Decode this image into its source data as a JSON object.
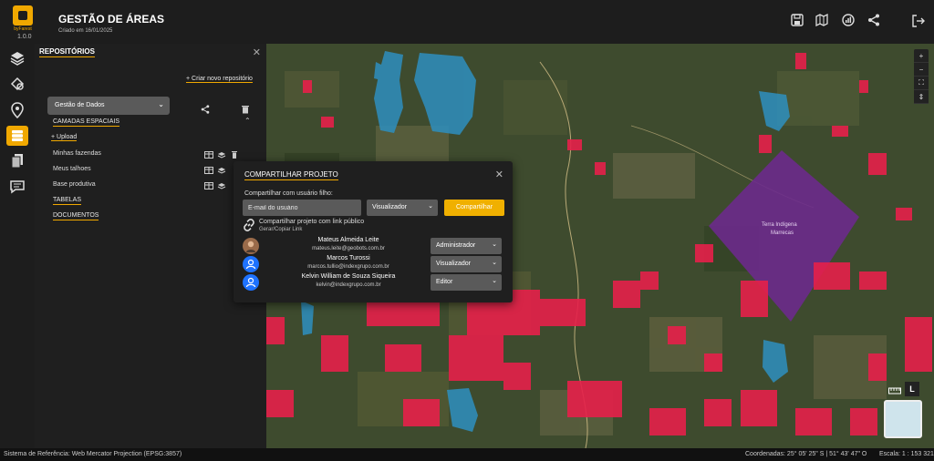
{
  "header": {
    "brand": "byFarest",
    "version": "1.0.0",
    "title": "GESTÃO DE ÁREAS",
    "subtitle": "Criado em 16/01/2025",
    "tools": [
      "save-icon",
      "map-signal-icon",
      "chart-icon",
      "share-icon"
    ],
    "logout_icon": "logout-icon"
  },
  "rail": {
    "items": [
      "layers-icon",
      "draw-icon",
      "pin-icon",
      "database-icon",
      "pages-icon",
      "chat-icon"
    ],
    "active_index": 3
  },
  "panel": {
    "title": "REPOSITÓRIOS",
    "create_link": "+ Criar novo repositório",
    "selected_repo": "Gestão de Dados",
    "sections": {
      "spatial_layers": "CAMADAS ESPACIAIS",
      "upload": "+ Upload",
      "tables": "TABELAS",
      "documents": "DOCUMENTOS"
    },
    "layers": [
      {
        "name": "Minhas fazendas"
      },
      {
        "name": "Meus talhoes"
      },
      {
        "name": "Base produtiva"
      }
    ]
  },
  "modal": {
    "title": "COMPARTILHAR PROJETO",
    "share_label": "Compartilhar com usuário filho:",
    "email_placeholder": "E-mail do usuário",
    "role_value": "Visualizador",
    "share_button": "Compartilhar",
    "public_link_text": "Compartilhar projeto com link público",
    "public_link_sub": "Gerar/Copiar Link",
    "users": [
      {
        "name": "Mateus Almeida Leite",
        "email": "mateus.leite@geobots.com.br",
        "role": "Administrador",
        "avatar": "photo"
      },
      {
        "name": "Marcos Turossi",
        "email": "marcos.tullio@indexgrupo.com.br",
        "role": "Visualizador",
        "avatar": "user-icon"
      },
      {
        "name": "Kelvin William de Souza Siqueira",
        "email": "kelvin@indexgrupo.com.br",
        "role": "Editor",
        "avatar": "user-icon"
      }
    ]
  },
  "map": {
    "labels": [
      {
        "text": "Terra Indígena"
      },
      {
        "text": "Marrecas"
      }
    ],
    "controls": [
      "+",
      "−",
      "⛶",
      "⇕"
    ],
    "basemap_button": "L",
    "colors": {
      "highlight": "#e6204a",
      "water": "#2e8fbf",
      "reserve": "#6b2a8c"
    }
  },
  "status": {
    "reference": "Sistema de Referência: Web Mercator Projection (EPSG:3857)",
    "coordinates": "Coordenadas: 25° 05' 25\" S | 51° 43' 47\" O",
    "scale": "Escala: 1 : 153 321"
  }
}
